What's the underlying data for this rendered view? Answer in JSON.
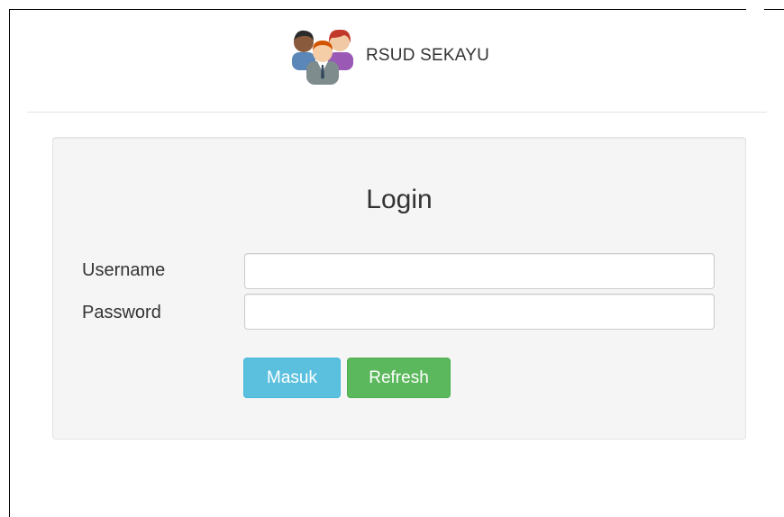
{
  "header": {
    "brand_name": "RSUD SEKAYU",
    "logo_icon": "users-group-icon"
  },
  "login": {
    "title": "Login",
    "username_label": "Username",
    "username_value": "",
    "password_label": "Password",
    "password_value": "",
    "masuk_label": "Masuk",
    "refresh_label": "Refresh"
  },
  "colors": {
    "masuk_button": "#5bc0de",
    "refresh_button": "#5cb85c",
    "panel_background": "#f5f5f5"
  }
}
